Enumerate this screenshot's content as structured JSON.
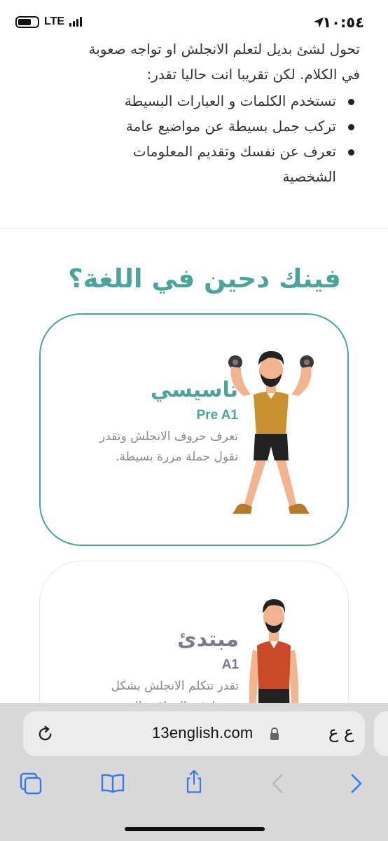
{
  "status_bar": {
    "time": "١٠:٥٤",
    "network": "LTE"
  },
  "intro": {
    "partial_line": "تحول لشئ بديل لتعلم الانجلش او تواجه صعوبة",
    "line2": "في الكلام. لكن تقريبا انت حاليا تقدر:",
    "bullets": [
      "تستخدم الكلمات و العبارات البسيطة",
      "تركب جمل بسيطة عن مواضيع عامة",
      "تعرف عن نفسك وتقديم المعلومات"
    ],
    "bullet3_cont": "الشخصية"
  },
  "section_title": "فينك دحين في اللغة؟",
  "levels": [
    {
      "title": "تاسيسي",
      "code": "Pre A1",
      "desc_line1": "تعرف حروف الانجلش وتقدر",
      "desc_line2": "تقول جملة مررة بسيطة."
    },
    {
      "title": "مبتدئ",
      "code": "A1",
      "desc_line1": "تقدر تتكلم الانجلش بشكل",
      "desc_line2": "بسيط في المواقف اليومية"
    }
  ],
  "browser": {
    "url": "13english.com",
    "aa_label": "ع ع"
  },
  "colors": {
    "accent": "#4aa49a",
    "safari_blue": "#3478f6",
    "muted_title": "#7a7a8a"
  },
  "icons": [
    "location-arrow-icon",
    "battery-icon",
    "signal-icon",
    "reload-icon",
    "lock-icon",
    "tabs-icon",
    "bookmarks-icon",
    "share-icon",
    "back-icon",
    "forward-icon"
  ]
}
